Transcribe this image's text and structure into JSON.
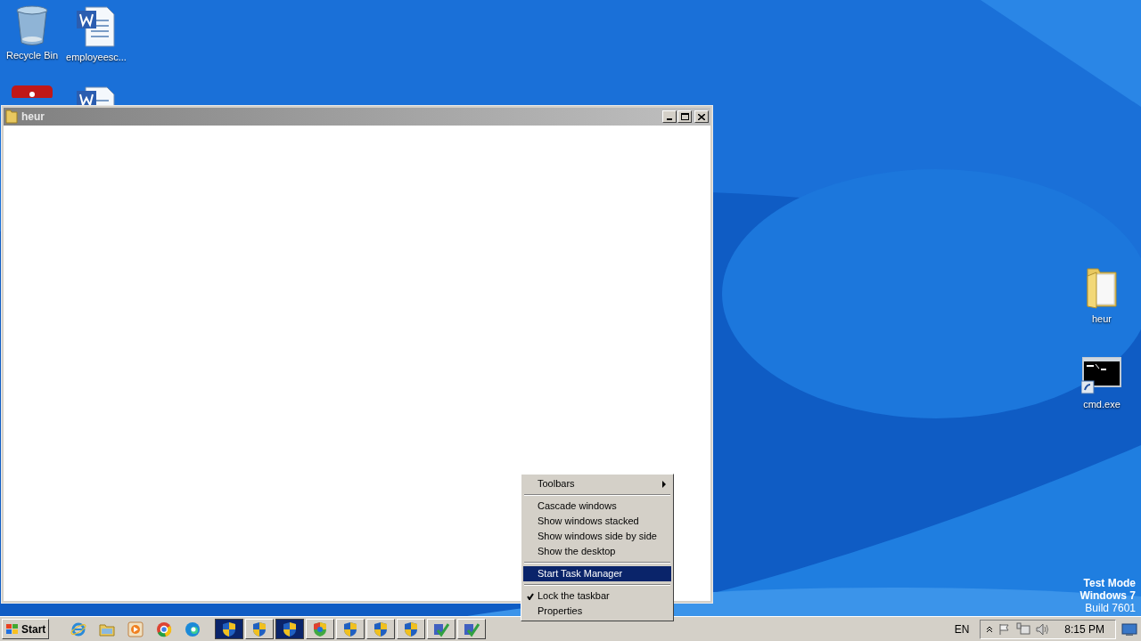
{
  "desktop_icons_left": [
    {
      "kind": "recycle",
      "label": "Recycle Bin"
    },
    {
      "kind": "doc",
      "label": "employeesc..."
    },
    {
      "kind": "red-app"
    },
    {
      "kind": "doc"
    }
  ],
  "desktop_icons_right": [
    {
      "kind": "folder",
      "label": "heur"
    },
    {
      "kind": "cmd",
      "label": "cmd.exe"
    }
  ],
  "window": {
    "title": "heur"
  },
  "context_menu": {
    "items": [
      {
        "kind": "item",
        "label": "Toolbars",
        "submenu": true,
        "checked": false,
        "selected": false
      },
      {
        "kind": "separator"
      },
      {
        "kind": "item",
        "label": "Cascade windows",
        "submenu": false,
        "checked": false,
        "selected": false
      },
      {
        "kind": "item",
        "label": "Show windows stacked",
        "submenu": false,
        "checked": false,
        "selected": false
      },
      {
        "kind": "item",
        "label": "Show windows side by side",
        "submenu": false,
        "checked": false,
        "selected": false
      },
      {
        "kind": "item",
        "label": "Show the desktop",
        "submenu": false,
        "checked": false,
        "selected": false
      },
      {
        "kind": "separator"
      },
      {
        "kind": "item",
        "label": "Start Task Manager",
        "submenu": false,
        "checked": false,
        "selected": true
      },
      {
        "kind": "separator"
      },
      {
        "kind": "item",
        "label": "Lock the taskbar",
        "submenu": false,
        "checked": true,
        "selected": false
      },
      {
        "kind": "item",
        "label": "Properties",
        "submenu": false,
        "checked": false,
        "selected": false
      }
    ]
  },
  "watermark_text": [
    "Test Mode",
    "Windows 7",
    "Build 7601"
  ],
  "taskbar": {
    "start_label": "Start",
    "quick_launch": [
      {
        "kind": "ie"
      },
      {
        "kind": "explorer"
      },
      {
        "kind": "media"
      },
      {
        "kind": "chrome"
      },
      {
        "kind": "edge"
      }
    ],
    "tasks": [
      {
        "kind": "shield",
        "highlighted": true
      },
      {
        "kind": "shield",
        "highlighted": false
      },
      {
        "kind": "shield",
        "highlighted": true
      },
      {
        "kind": "color-shield",
        "highlighted": false
      },
      {
        "kind": "shield",
        "highlighted": false
      },
      {
        "kind": "shield",
        "highlighted": false
      },
      {
        "kind": "shield",
        "highlighted": false
      },
      {
        "kind": "installer",
        "highlighted": false
      },
      {
        "kind": "installer",
        "highlighted": false
      }
    ],
    "language": "EN",
    "clock": "8:15 PM"
  }
}
